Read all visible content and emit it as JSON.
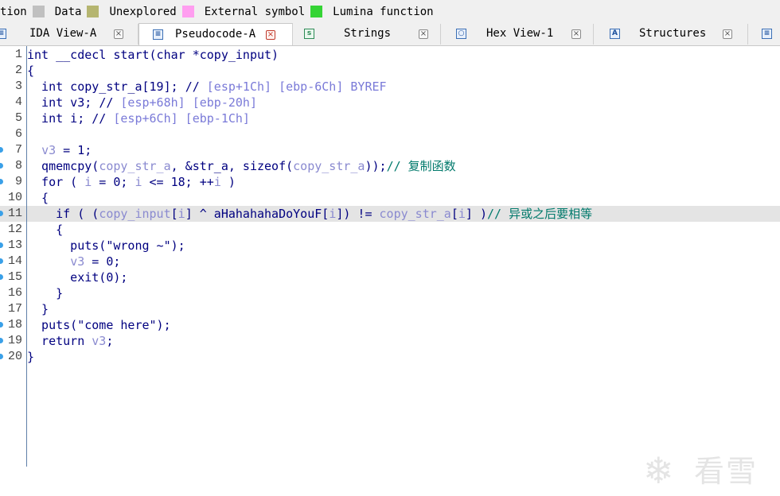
{
  "legend": [
    {
      "label": "tion",
      "color": ""
    },
    {
      "label": "Data",
      "color": "#c0c0c0"
    },
    {
      "label": "Unexplored",
      "color": "#b5b570"
    },
    {
      "label": "External symbol",
      "color": "#ff9ef0"
    },
    {
      "label": "Lumina function",
      "color": "#35d435"
    }
  ],
  "tabs": [
    {
      "label": "IDA View-A",
      "icon": "ida-view-icon"
    },
    {
      "label": "Pseudocode-A",
      "icon": "pseudocode-icon",
      "active": true
    },
    {
      "label": "Strings",
      "icon": "strings-icon"
    },
    {
      "label": "Hex View-1",
      "icon": "hex-view-icon"
    },
    {
      "label": "Structures",
      "icon": "structures-icon"
    }
  ],
  "code": {
    "lines": [
      {
        "n": "1",
        "text": "int __cdecl start(char *copy_input)"
      },
      {
        "n": "2",
        "text": "{"
      },
      {
        "n": "3",
        "text": "  int copy_str_a[19]; // [esp+1Ch] [ebp-6Ch] BYREF"
      },
      {
        "n": "4",
        "text": "  int v3; // [esp+68h] [ebp-20h]"
      },
      {
        "n": "5",
        "text": "  int i; // [esp+6Ch] [ebp-1Ch]"
      },
      {
        "n": "6",
        "text": ""
      },
      {
        "n": "7",
        "text": "  v3 = 1;"
      },
      {
        "n": "8",
        "text": "  qmemcpy(copy_str_a, &str_a, sizeof(copy_str_a));// 复制函数"
      },
      {
        "n": "9",
        "text": "  for ( i = 0; i <= 18; ++i )"
      },
      {
        "n": "10",
        "text": "  {"
      },
      {
        "n": "11",
        "text": "    if ( (copy_input[i] ^ aHahahahaDoYouF[i]) != copy_str_a[i] )// 异或之后要相等"
      },
      {
        "n": "12",
        "text": "    {"
      },
      {
        "n": "13",
        "text": "      puts(\"wrong ~\");"
      },
      {
        "n": "14",
        "text": "      v3 = 0;"
      },
      {
        "n": "15",
        "text": "      exit(0);"
      },
      {
        "n": "16",
        "text": "    }"
      },
      {
        "n": "17",
        "text": "  }"
      },
      {
        "n": "18",
        "text": "  puts(\"come here\");"
      },
      {
        "n": "19",
        "text": "  return v3;"
      },
      {
        "n": "20",
        "text": "}"
      }
    ],
    "highlighted_line": "11",
    "breakpoint_lines": [
      "7",
      "8",
      "9",
      "11",
      "13",
      "14",
      "15",
      "18",
      "19",
      "20"
    ]
  },
  "colors": {
    "keyword": "#000080",
    "variable": "#8a8ad0",
    "comment": "#00796b",
    "highlight_row": "#e4e4e4"
  },
  "watermark": {
    "text": "看雪",
    "icon": "snowflake-logo-icon"
  }
}
